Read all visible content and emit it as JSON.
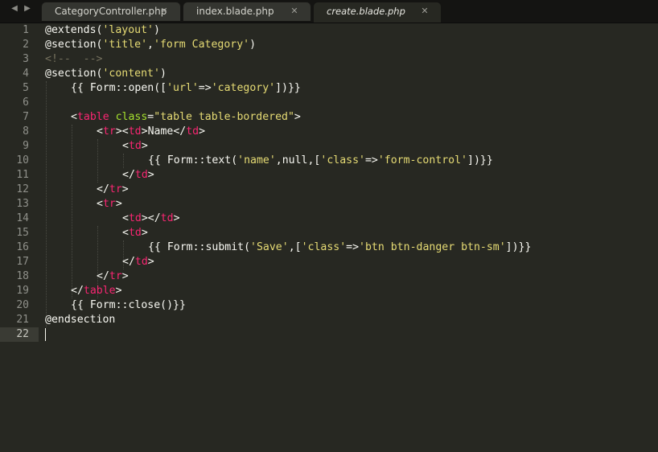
{
  "tabs": [
    {
      "label": "CategoryController.php",
      "active": false
    },
    {
      "label": "index.blade.php",
      "active": false
    },
    {
      "label": "create.blade.php",
      "active": true
    }
  ],
  "nav": {
    "back_glyph": "◀",
    "forward_glyph": "▶",
    "close_glyph": "✕"
  },
  "line_numbers": [
    "1",
    "2",
    "3",
    "4",
    "5",
    "6",
    "7",
    "8",
    "9",
    "10",
    "11",
    "12",
    "13",
    "14",
    "15",
    "16",
    "17",
    "18",
    "19",
    "20",
    "21",
    "22"
  ],
  "code": {
    "l1": {
      "a": "@extends(",
      "b": "'layout'",
      "c": ")"
    },
    "l2": {
      "a": "@section(",
      "b": "'title'",
      "c": ",",
      "d": "'form Category'",
      "e": ")"
    },
    "l3": {
      "a": "<!--  -->"
    },
    "l4": {
      "a": "@section(",
      "b": "'content'",
      "c": ")"
    },
    "l5": {
      "a": "{{ Form::open([",
      "b": "'url'",
      "c": "=>",
      "d": "'category'",
      "e": "])}}"
    },
    "l7": {
      "a": "<",
      "b": "table",
      "c": " class",
      "d": "=",
      "e": "\"table table-bordered\"",
      "f": ">"
    },
    "l8": {
      "a": "<",
      "b": "tr",
      "c": "><",
      "d": "td",
      "e": ">Name</",
      "f": "td",
      "g": ">"
    },
    "l9": {
      "a": "<",
      "b": "td",
      "c": ">"
    },
    "l10": {
      "a": "{{ Form::text(",
      "b": "'name'",
      "c": ",null,[",
      "d": "'class'",
      "e": "=>",
      "f": "'form-control'",
      "g": "])}}"
    },
    "l11": {
      "a": "</",
      "b": "td",
      "c": ">"
    },
    "l12": {
      "a": "</",
      "b": "tr",
      "c": ">"
    },
    "l13": {
      "a": "<",
      "b": "tr",
      "c": ">"
    },
    "l14": {
      "a": "<",
      "b": "td",
      "c": "></",
      "d": "td",
      "e": ">"
    },
    "l15": {
      "a": "<",
      "b": "td",
      "c": ">"
    },
    "l16": {
      "a": "{{ Form::submit(",
      "b": "'Save'",
      "c": ",[",
      "d": "'class'",
      "e": "=>",
      "f": "'btn btn-danger btn-sm'",
      "g": "])}}"
    },
    "l17": {
      "a": "</",
      "b": "td",
      "c": ">"
    },
    "l18": {
      "a": "</",
      "b": "tr",
      "c": ">"
    },
    "l19": {
      "a": "</",
      "b": "table",
      "c": ">"
    },
    "l20": {
      "a": "{{ Form::close()}}"
    },
    "l21": {
      "a": "@endsection"
    }
  },
  "colors": {
    "background": "#272822",
    "text": "#f8f8f2",
    "string": "#e6db74",
    "tag": "#f92672",
    "attribute": "#a6e22e",
    "comment": "#75715e",
    "line_number": "#8f908a"
  }
}
